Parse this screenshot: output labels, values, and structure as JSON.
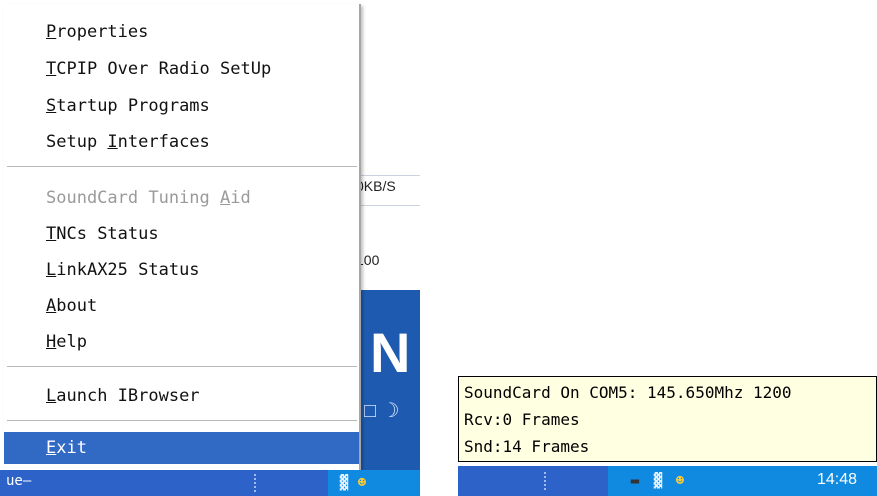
{
  "context_menu": {
    "items": [
      {
        "label": "Properties",
        "mnemonic": "P",
        "enabled": true
      },
      {
        "label": "TCPIP Over Radio SetUp",
        "mnemonic": "T",
        "enabled": true
      },
      {
        "label": "Startup Programs",
        "mnemonic": "S",
        "enabled": true
      },
      {
        "label": "Setup Interfaces",
        "mnemonic": "I",
        "enabled": true
      },
      {
        "label": "SoundCard Tuning Aid",
        "mnemonic": "A",
        "enabled": false
      },
      {
        "label": "TNCs Status",
        "mnemonic": "T",
        "enabled": true
      },
      {
        "label": "LinkAX25 Status",
        "mnemonic": "L",
        "enabled": true
      },
      {
        "label": "About",
        "mnemonic": "A",
        "enabled": true
      },
      {
        "label": "Help",
        "mnemonic": "H",
        "enabled": true
      },
      {
        "label": "Launch IBrowser",
        "mnemonic": "L",
        "enabled": true
      },
      {
        "label": "Exit",
        "mnemonic": "E",
        "enabled": true,
        "selected": true
      }
    ]
  },
  "background_window": {
    "fragment_1": "0KB/S",
    "fragment_2": "100",
    "fragment_3": "N"
  },
  "taskbar_left": {
    "text_fragment": "ue"
  },
  "tray_tooltip": {
    "lines": [
      "SoundCard On COM5: 145.650Mhz 1200",
      "Rcv:0 Frames",
      "Snd:14 Frames"
    ]
  },
  "taskbar_right": {
    "clock": "14:48"
  },
  "colors": {
    "menu_highlight": "#316ac5",
    "taskbar": "#2d63c8",
    "tray": "#0f8ae0",
    "tooltip_bg": "#ffffe1"
  },
  "icons": [
    "network-tray-icon",
    "qq-penguin-icon",
    "keyboard-tray-icon"
  ]
}
